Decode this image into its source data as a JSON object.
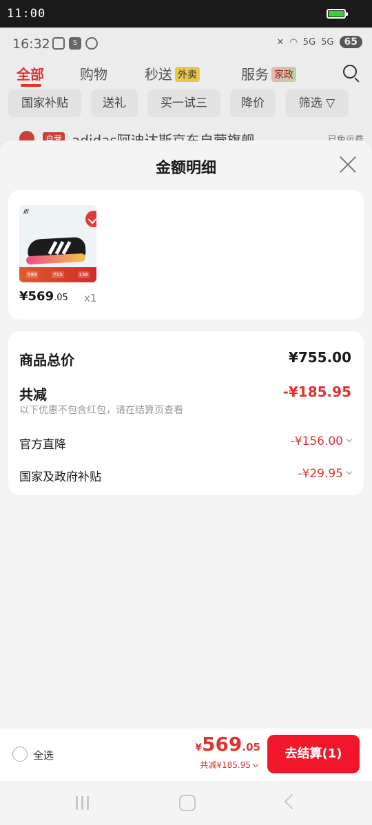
{
  "status_bar": {
    "time": "11:00"
  },
  "background_app": {
    "status_time": "16:32",
    "status_icons": [
      "screenshot-icon",
      "s-icon",
      "app-icon"
    ],
    "battery_level": "65",
    "net_label": "5G",
    "tabs": [
      {
        "label": "全部",
        "active": true
      },
      {
        "label": "购物"
      },
      {
        "label": "秒送",
        "badge": "外卖"
      },
      {
        "label": "服务",
        "badge": "家政"
      }
    ],
    "filters": [
      "国家补贴",
      "送礼",
      "买一试三",
      "降价",
      "筛选"
    ],
    "store": {
      "tag": "自营",
      "name": "adidas阿迪达斯京东自营旗舰",
      "shipping_note": "已免运费"
    }
  },
  "sheet": {
    "title": "金额明细",
    "product": {
      "price_main": "¥569",
      "price_decimal": ".05",
      "quantity": "x1",
      "strip_values": [
        "599",
        "755",
        "156"
      ]
    },
    "details": {
      "total_label": "商品总价",
      "total_value": "¥755.00",
      "discount_label": "共减",
      "discount_value": "-¥185.95",
      "discount_note": "以下优惠不包含红包，请在结算页查看",
      "items": [
        {
          "label": "官方直降",
          "value": "-¥156.00"
        },
        {
          "label": "国家及政府补贴",
          "value": "-¥29.95"
        }
      ]
    }
  },
  "checkout": {
    "select_all_label": "全选",
    "currency": "¥",
    "price_int": "569",
    "price_decimal": ".05",
    "discount_text": "共减¥185.95",
    "button_label": "去结算(1)"
  },
  "colors": {
    "accent_red": "#e0322e",
    "button_red": "#f1162a"
  }
}
